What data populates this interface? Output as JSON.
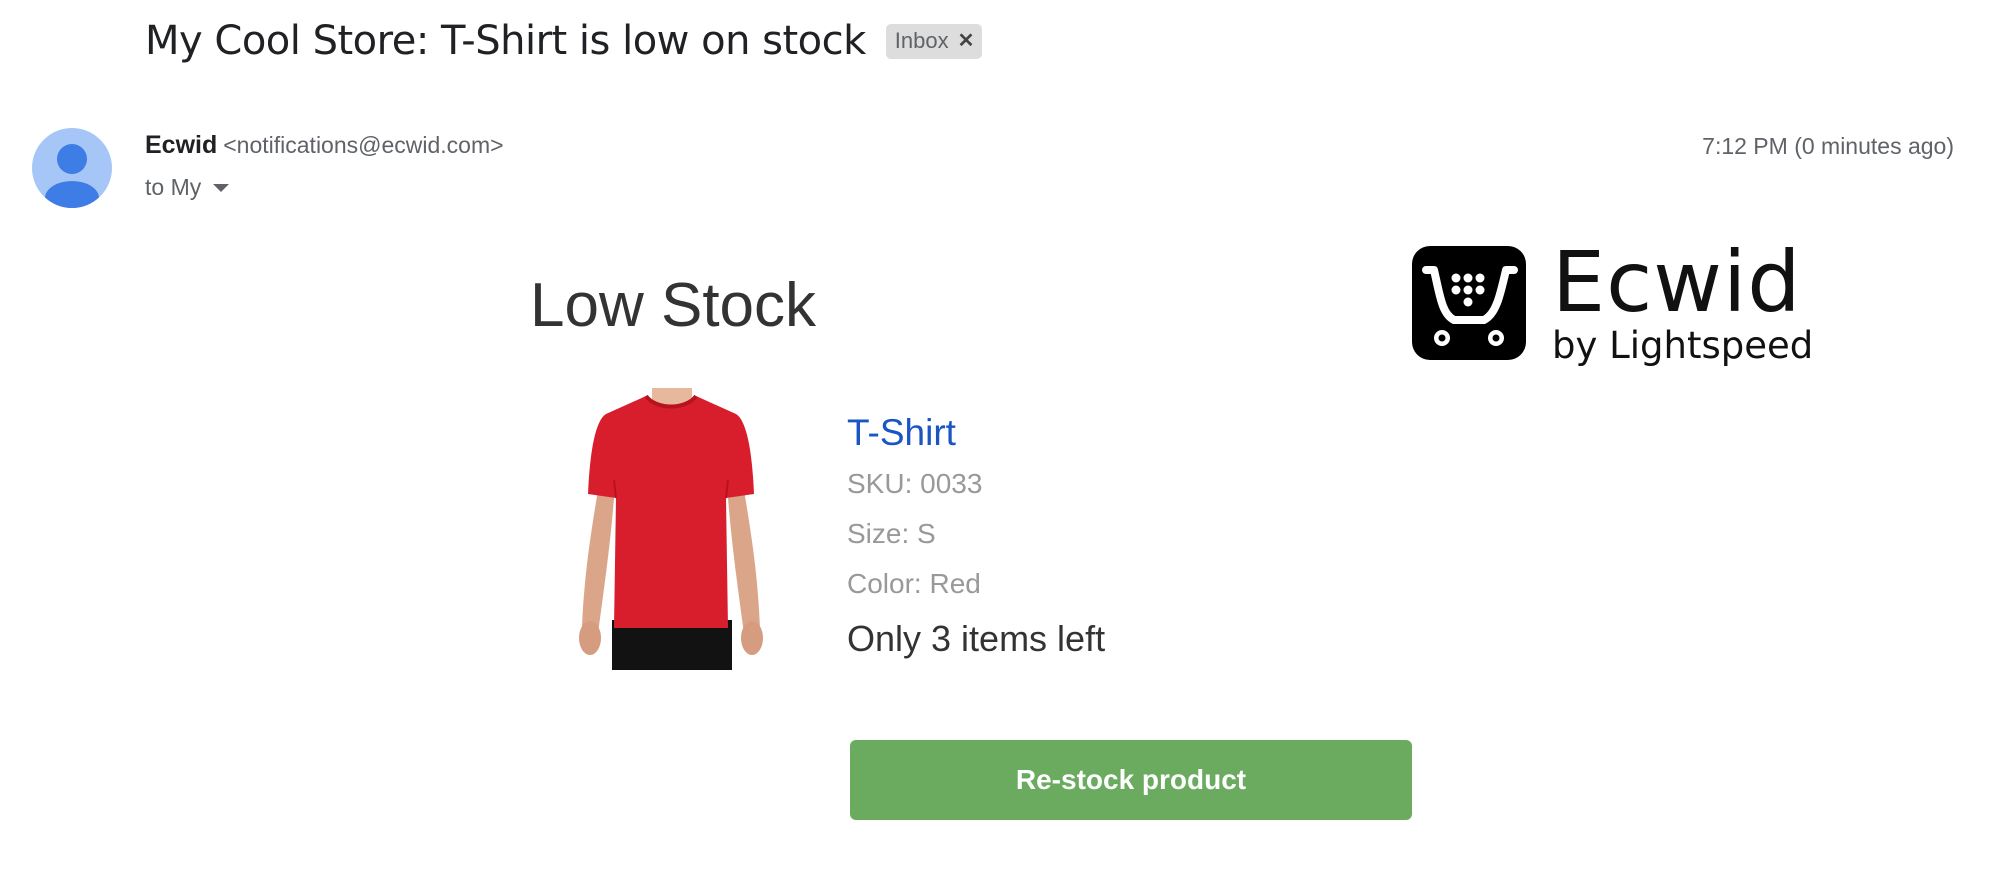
{
  "email": {
    "subject": "My Cool Store: T-Shirt is low on stock",
    "label": "Inbox",
    "label_remove_icon": "close-icon",
    "sender_name": "Ecwid",
    "sender_email": "<notifications@ecwid.com>",
    "recipient": "to My",
    "timestamp": "7:12 PM (0 minutes ago)",
    "avatar_icon": "person-icon"
  },
  "body": {
    "headline": "Low Stock",
    "logo": {
      "icon": "shopping-cart-icon",
      "word": "Ecwid",
      "tagline": "by Lightspeed"
    },
    "product": {
      "image": "red-t-shirt-photo",
      "name": "T-Shirt",
      "sku": "SKU: 0033",
      "size": "Size: S",
      "color": "Color: Red",
      "stock_note": "Only 3 items left"
    },
    "cta_label": "Re-stock product"
  },
  "colors": {
    "link": "#1a55c4",
    "cta": "#6aab5f",
    "meta_text": "#999999",
    "avatar_bg": "#a5c6f6",
    "avatar_figure": "#3f7de6",
    "shirt": "#d81e2c"
  }
}
